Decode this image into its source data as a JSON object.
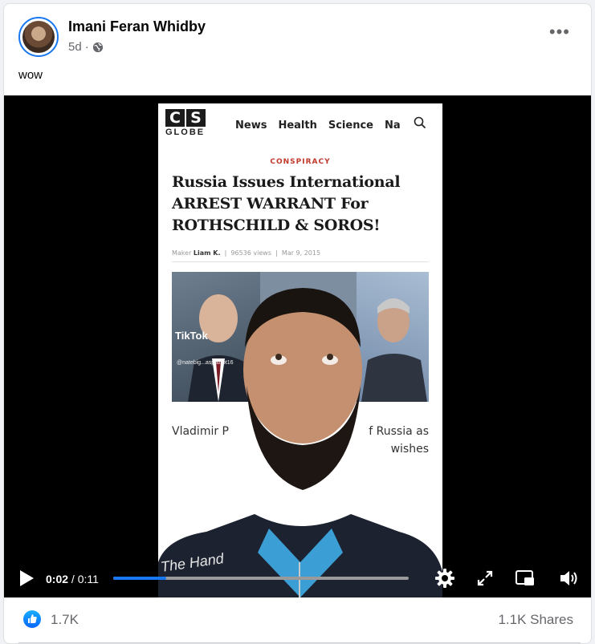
{
  "post": {
    "author": "Imani Feran Whidby",
    "time": "5d",
    "meta_dot": "·",
    "visibility_icon": "globe-icon",
    "caption": "wow",
    "more_icon": "more-options-icon"
  },
  "video": {
    "site": {
      "logo_letters": [
        "C",
        "S"
      ],
      "logo_sub": "GLOBE",
      "nav": [
        "News",
        "Health",
        "Science",
        "Na"
      ],
      "category": "CONSPIRACY",
      "headline": "Russia Issues International ARREST WARRANT For ROTHSCHILD & SOROS!",
      "byline_label": "Maker",
      "byline_author": "Liam K.",
      "byline_views": "96536 views",
      "byline_date": "Mar 9, 2015",
      "tiktok_mark": "TikTok",
      "tiktok_handle": "@natebig...aspatriot16",
      "body_left": "Vladimir P",
      "body_right": "f Russia as",
      "body_line2": "wishes",
      "shirt_text": "The Hand"
    },
    "current_time": "0:02",
    "separator": "/",
    "duration": "0:11",
    "progress_fraction": 0.18,
    "accent": "#1877f2"
  },
  "footer": {
    "like_count": "1.7K",
    "shares": "1.1K Shares"
  }
}
